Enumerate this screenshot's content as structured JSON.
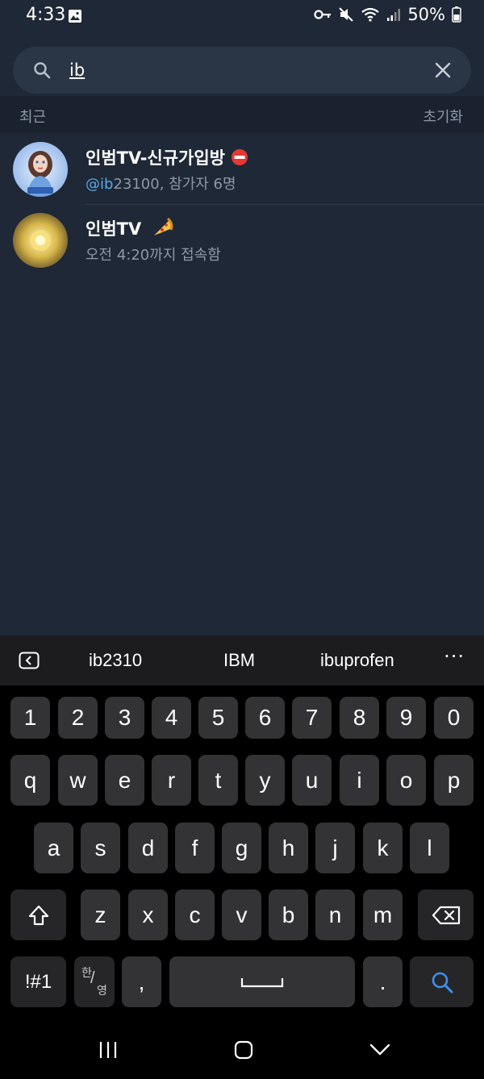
{
  "status_bar": {
    "time": "4:33",
    "battery": "50%"
  },
  "search": {
    "query": "ib",
    "placeholder": ""
  },
  "recent": {
    "title": "최근",
    "reset_label": "초기화"
  },
  "results": [
    {
      "title": "인범TV-신규가입방",
      "badge_icon": "no-entry-icon",
      "handle": "@ib",
      "sub_rest": "23100, 참가자 6명"
    },
    {
      "title": "인범TV",
      "badge_icon": "pizza-icon",
      "subtitle": "오전 4:20까지 접속함"
    }
  ],
  "keyboard": {
    "suggestions": [
      "ib2310",
      "IBM",
      "ibuprofen"
    ],
    "more": "···",
    "number_row": [
      "1",
      "2",
      "3",
      "4",
      "5",
      "6",
      "7",
      "8",
      "9",
      "0"
    ],
    "row1": [
      "q",
      "w",
      "e",
      "r",
      "t",
      "y",
      "u",
      "i",
      "o",
      "p"
    ],
    "row2": [
      "a",
      "s",
      "d",
      "f",
      "g",
      "h",
      "j",
      "k",
      "l"
    ],
    "row3": [
      "z",
      "x",
      "c",
      "v",
      "b",
      "n",
      "m"
    ],
    "symbols_key": "!#1",
    "lang_top": "한",
    "lang_bottom": "영",
    "comma": ",",
    "period": "."
  },
  "colors": {
    "background": "#1e2836",
    "accent": "#5aa9e6",
    "muted": "#8d99a6",
    "key": "#333335"
  }
}
